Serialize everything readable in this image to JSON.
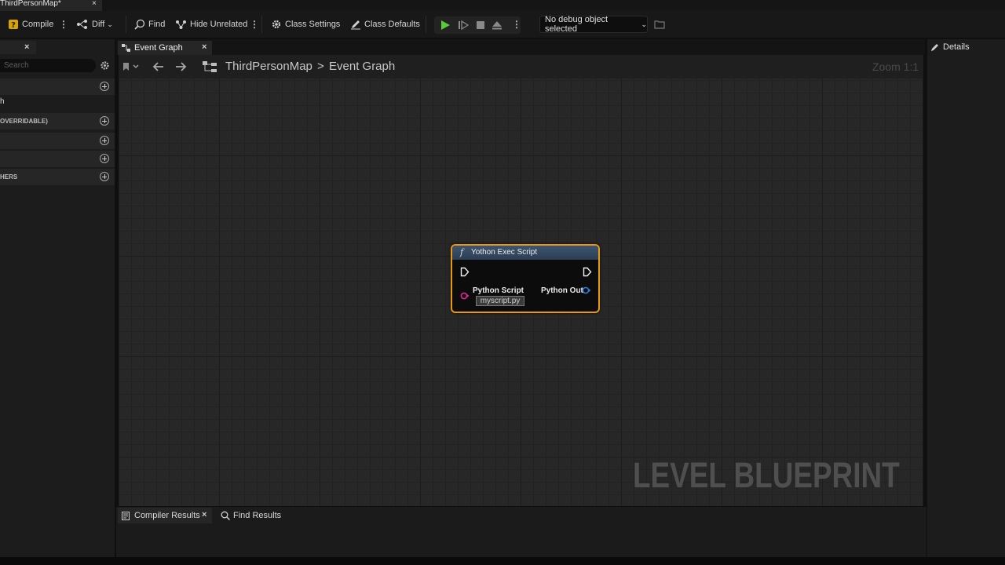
{
  "window": {
    "tab_title": "ThirdPersonMap*",
    "close_glyph": "×"
  },
  "toolbar": {
    "compile_label": "Compile",
    "diff_label": "Diff",
    "find_label": "Find",
    "hide_unrelated_label": "Hide Unrelated",
    "class_settings_label": "Class Settings",
    "class_defaults_label": "Class Defaults",
    "debug_object_label": "No debug object selected",
    "play_color": "#5cc93b"
  },
  "left_panel": {
    "tab_close": "×",
    "search_placeholder": "Search",
    "rows": [
      {
        "label": ""
      },
      {
        "label": "h"
      },
      {
        "label": "OVERRIDABLE)"
      },
      {
        "label": ""
      },
      {
        "label": ""
      },
      {
        "label": "HERS"
      }
    ]
  },
  "graph": {
    "tab_label": "Event Graph",
    "breadcrumb_root": "ThirdPersonMap",
    "breadcrumb_separator": ">",
    "breadcrumb_current": "Event Graph",
    "zoom_label": "Zoom 1:1",
    "watermark": "LEVEL BLUEPRINT"
  },
  "node": {
    "title": "Yothon Exec Script",
    "function_glyph": "f",
    "input_pin_label": "Python Script",
    "input_pin_value": "myscript.py",
    "output_pin_label": "Python Out",
    "border_color": "#e89a0c",
    "input_pin_color": "#e0249a",
    "output_pin_color": "#2f7bd9"
  },
  "details": {
    "title": "Details"
  },
  "bottom": {
    "compiler_results_label": "Compiler Results",
    "find_results_label": "Find Results"
  }
}
